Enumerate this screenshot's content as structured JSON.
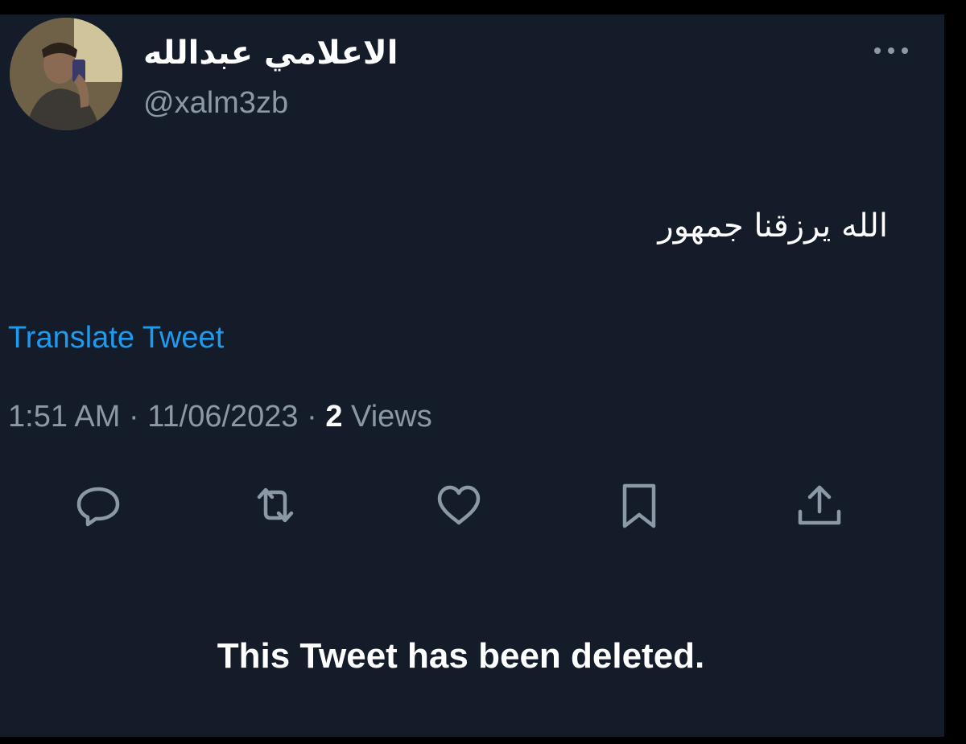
{
  "tweet": {
    "author": {
      "display_name": "الاعلامي عبدالله",
      "handle": "@xalm3zb"
    },
    "text": "الله يرزقنا جمهور",
    "translate_label": "Translate Tweet",
    "time": "1:51 AM",
    "separator": " · ",
    "date": "11/06/2023",
    "views_count": "2",
    "views_label": " Views",
    "actions": [
      {
        "name": "reply",
        "icon": "speech-bubble-icon"
      },
      {
        "name": "retweet",
        "icon": "retweet-arrows-icon"
      },
      {
        "name": "like",
        "icon": "heart-icon"
      },
      {
        "name": "bookmark",
        "icon": "bookmark-icon"
      },
      {
        "name": "share",
        "icon": "share-upload-icon"
      }
    ],
    "more_icon": "ellipsis-icon"
  },
  "deleted_notice": "This Tweet has been deleted.",
  "colors": {
    "background": "#151c29",
    "text_primary": "#ffffff",
    "text_secondary": "#8b98a5",
    "link": "#1d9bf0",
    "icon": "#8b98a5"
  }
}
